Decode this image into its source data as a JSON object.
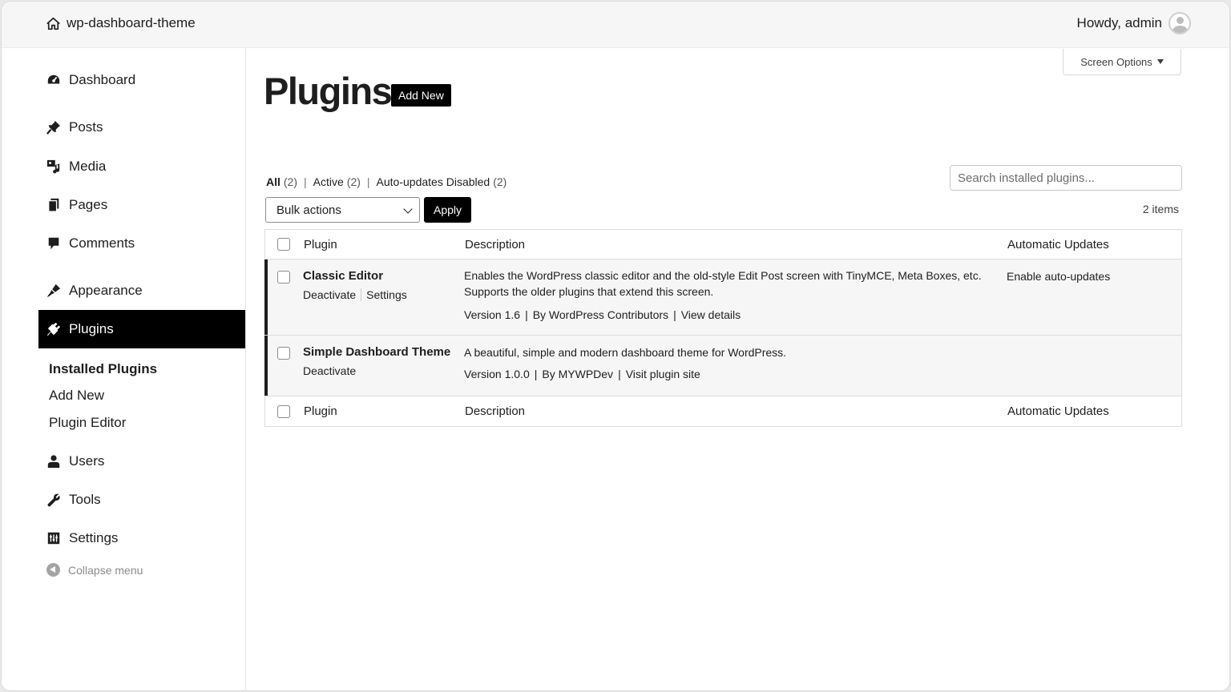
{
  "topbar": {
    "site_name": "wp-dashboard-theme",
    "greeting": "Howdy, admin"
  },
  "sidebar": {
    "items": [
      {
        "label": "Dashboard",
        "icon": "dashboard-icon"
      },
      {
        "label": "Posts",
        "icon": "pin-icon"
      },
      {
        "label": "Media",
        "icon": "media-icon"
      },
      {
        "label": "Pages",
        "icon": "pages-icon"
      },
      {
        "label": "Comments",
        "icon": "comment-icon"
      },
      {
        "label": "Appearance",
        "icon": "brush-icon"
      },
      {
        "label": "Plugins",
        "icon": "plugin-icon"
      },
      {
        "label": "Users",
        "icon": "user-icon"
      },
      {
        "label": "Tools",
        "icon": "wrench-icon"
      },
      {
        "label": "Settings",
        "icon": "settings-icon"
      }
    ],
    "submenu": [
      "Installed Plugins",
      "Add New",
      "Plugin Editor"
    ],
    "collapse_label": "Collapse menu"
  },
  "main": {
    "screen_options": "Screen Options",
    "title": "Plugins",
    "add_new": "Add New",
    "filters": [
      {
        "label": "All",
        "count": "(2)"
      },
      {
        "label": "Active",
        "count": "(2)"
      },
      {
        "label": "Auto-updates Disabled",
        "count": "(2)"
      }
    ],
    "search_placeholder": "Search installed plugins...",
    "bulk_actions": "Bulk actions",
    "apply": "Apply",
    "items_count": "2 items",
    "columns": {
      "plugin": "Plugin",
      "description": "Description",
      "auto_updates": "Automatic Updates"
    },
    "plugins": [
      {
        "name": "Classic Editor",
        "actions": [
          "Deactivate",
          "Settings"
        ],
        "description": "Enables the WordPress classic editor and the old-style Edit Post screen with TinyMCE, Meta Boxes, etc. Supports the older plugins that extend this screen.",
        "version": "Version 1.6",
        "author": "By WordPress Contributors",
        "link": "View details",
        "auto_update": "Enable auto-updates"
      },
      {
        "name": "Simple Dashboard Theme",
        "actions": [
          "Deactivate"
        ],
        "description": "A beautiful, simple and modern dashboard theme for WordPress.",
        "version": "Version 1.0.0",
        "author": "By MYWPDev",
        "link": "Visit plugin site",
        "auto_update": ""
      }
    ]
  }
}
